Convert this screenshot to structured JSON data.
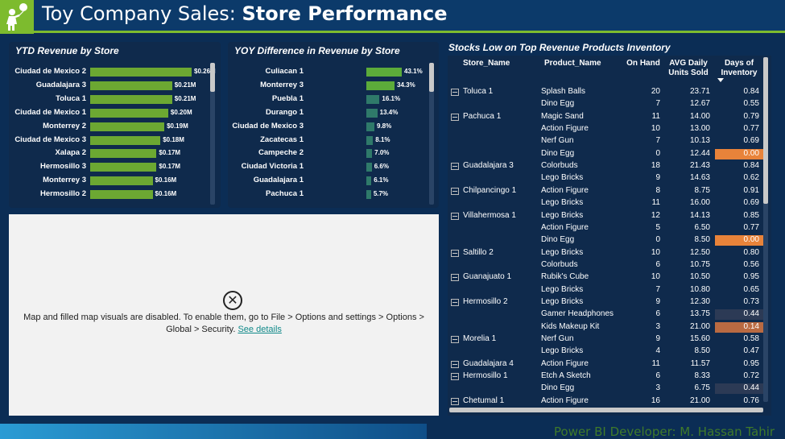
{
  "header": {
    "title_prefix": "Toy Company Sales: ",
    "title_bold": "Store Performance"
  },
  "ytd": {
    "title": "YTD Revenue by Store",
    "bar_color": "#6ca832",
    "max": 0.26,
    "rows": [
      {
        "store": "Ciudad de Mexico 2",
        "value": 0.26,
        "label": "$0.26M"
      },
      {
        "store": "Guadalajara 3",
        "value": 0.21,
        "label": "$0.21M"
      },
      {
        "store": "Toluca 1",
        "value": 0.21,
        "label": "$0.21M"
      },
      {
        "store": "Ciudad de Mexico 1",
        "value": 0.2,
        "label": "$0.20M"
      },
      {
        "store": "Monterrey 2",
        "value": 0.19,
        "label": "$0.19M"
      },
      {
        "store": "Ciudad de Mexico 3",
        "value": 0.18,
        "label": "$0.18M"
      },
      {
        "store": "Xalapa 2",
        "value": 0.17,
        "label": "$0.17M"
      },
      {
        "store": "Hermosillo 3",
        "value": 0.17,
        "label": "$0.17M"
      },
      {
        "store": "Monterrey 3",
        "value": 0.16,
        "label": "$0.16M"
      },
      {
        "store": "Hermosillo 2",
        "value": 0.16,
        "label": "$0.16M"
      }
    ]
  },
  "yoy": {
    "title": "YOY Difference in Revenue by Store",
    "bar_color_high": "#5cab3a",
    "bar_color_low": "#2f7a6a",
    "max": 43.1,
    "rows": [
      {
        "store": "Culiacan 1",
        "value": 43.1,
        "label": "43.1%"
      },
      {
        "store": "Monterrey 3",
        "value": 34.3,
        "label": "34.3%"
      },
      {
        "store": "Puebla 1",
        "value": 16.1,
        "label": "16.1%"
      },
      {
        "store": "Durango 1",
        "value": 13.4,
        "label": "13.4%"
      },
      {
        "store": "Ciudad de Mexico 3",
        "value": 9.8,
        "label": "9.8%"
      },
      {
        "store": "Zacatecas 1",
        "value": 8.1,
        "label": "8.1%"
      },
      {
        "store": "Campeche 2",
        "value": 7.0,
        "label": "7.0%"
      },
      {
        "store": "Ciudad Victoria 1",
        "value": 6.6,
        "label": "6.6%"
      },
      {
        "store": "Guadalajara 1",
        "value": 6.1,
        "label": "6.1%"
      },
      {
        "store": "Pachuca 1",
        "value": 5.7,
        "label": "5.7%"
      }
    ]
  },
  "map": {
    "icon": "close-circle-icon",
    "message": "Map and filled map visuals are disabled. To enable them, go to File > Options and settings > Options > Global > Security.",
    "link": "See details"
  },
  "table": {
    "title": "Stocks Low on Top Revenue Products Inventory",
    "headers": {
      "store": "Store_Name",
      "product": "Product_Name",
      "on_hand": "On Hand",
      "avg_line1": "AVG Daily",
      "avg_line2": "Units Sold",
      "days_line1": "Days of",
      "days_line2": "Inventory"
    },
    "rows": [
      {
        "store": "Toluca 1",
        "product": "Splash Balls",
        "on_hand": "20",
        "avg": "23.71",
        "days": "0.84",
        "hl": ""
      },
      {
        "store": "",
        "product": "Dino Egg",
        "on_hand": "7",
        "avg": "12.67",
        "days": "0.55",
        "hl": ""
      },
      {
        "store": "Pachuca 1",
        "product": "Magic Sand",
        "on_hand": "11",
        "avg": "14.00",
        "days": "0.79",
        "hl": ""
      },
      {
        "store": "",
        "product": "Action Figure",
        "on_hand": "10",
        "avg": "13.00",
        "days": "0.77",
        "hl": ""
      },
      {
        "store": "",
        "product": "Nerf Gun",
        "on_hand": "7",
        "avg": "10.13",
        "days": "0.69",
        "hl": ""
      },
      {
        "store": "",
        "product": "Dino Egg",
        "on_hand": "0",
        "avg": "12.44",
        "days": "0.00",
        "hl": "#e8833a"
      },
      {
        "store": "Guadalajara 3",
        "product": "Colorbuds",
        "on_hand": "18",
        "avg": "21.43",
        "days": "0.84",
        "hl": ""
      },
      {
        "store": "",
        "product": "Lego Bricks",
        "on_hand": "9",
        "avg": "14.63",
        "days": "0.62",
        "hl": ""
      },
      {
        "store": "Chilpancingo 1",
        "product": "Action Figure",
        "on_hand": "8",
        "avg": "8.75",
        "days": "0.91",
        "hl": ""
      },
      {
        "store": "",
        "product": "Lego Bricks",
        "on_hand": "11",
        "avg": "16.00",
        "days": "0.69",
        "hl": ""
      },
      {
        "store": "Villahermosa 1",
        "product": "Lego Bricks",
        "on_hand": "12",
        "avg": "14.13",
        "days": "0.85",
        "hl": ""
      },
      {
        "store": "",
        "product": "Action Figure",
        "on_hand": "5",
        "avg": "6.50",
        "days": "0.77",
        "hl": ""
      },
      {
        "store": "",
        "product": "Dino Egg",
        "on_hand": "0",
        "avg": "8.50",
        "days": "0.00",
        "hl": "#e8833a"
      },
      {
        "store": "Saltillo 2",
        "product": "Lego Bricks",
        "on_hand": "10",
        "avg": "12.50",
        "days": "0.80",
        "hl": ""
      },
      {
        "store": "",
        "product": "Colorbuds",
        "on_hand": "6",
        "avg": "10.75",
        "days": "0.56",
        "hl": ""
      },
      {
        "store": "Guanajuato 1",
        "product": "Rubik's Cube",
        "on_hand": "10",
        "avg": "10.50",
        "days": "0.95",
        "hl": ""
      },
      {
        "store": "",
        "product": "Lego Bricks",
        "on_hand": "7",
        "avg": "10.80",
        "days": "0.65",
        "hl": ""
      },
      {
        "store": "Hermosillo 2",
        "product": "Lego Bricks",
        "on_hand": "9",
        "avg": "12.30",
        "days": "0.73",
        "hl": ""
      },
      {
        "store": "",
        "product": "Gamer Headphones",
        "on_hand": "6",
        "avg": "13.75",
        "days": "0.44",
        "hl": "#2c3a55"
      },
      {
        "store": "",
        "product": "Kids Makeup Kit",
        "on_hand": "3",
        "avg": "21.00",
        "days": "0.14",
        "hl": "#b96a42"
      },
      {
        "store": "Morelia 1",
        "product": "Nerf Gun",
        "on_hand": "9",
        "avg": "15.60",
        "days": "0.58",
        "hl": ""
      },
      {
        "store": "",
        "product": "Lego Bricks",
        "on_hand": "4",
        "avg": "8.50",
        "days": "0.47",
        "hl": ""
      },
      {
        "store": "Guadalajara 4",
        "product": "Action Figure",
        "on_hand": "11",
        "avg": "11.57",
        "days": "0.95",
        "hl": ""
      },
      {
        "store": "Hermosillo 1",
        "product": "Etch A Sketch",
        "on_hand": "6",
        "avg": "8.33",
        "days": "0.72",
        "hl": ""
      },
      {
        "store": "",
        "product": "Dino Egg",
        "on_hand": "3",
        "avg": "6.75",
        "days": "0.44",
        "hl": "#2c3a55"
      },
      {
        "store": "Chetumal 1",
        "product": "Action Figure",
        "on_hand": "16",
        "avg": "21.00",
        "days": "0.76",
        "hl": ""
      }
    ]
  },
  "footer": {
    "credit": "Power BI Developer: M. Hassan Tahir"
  }
}
